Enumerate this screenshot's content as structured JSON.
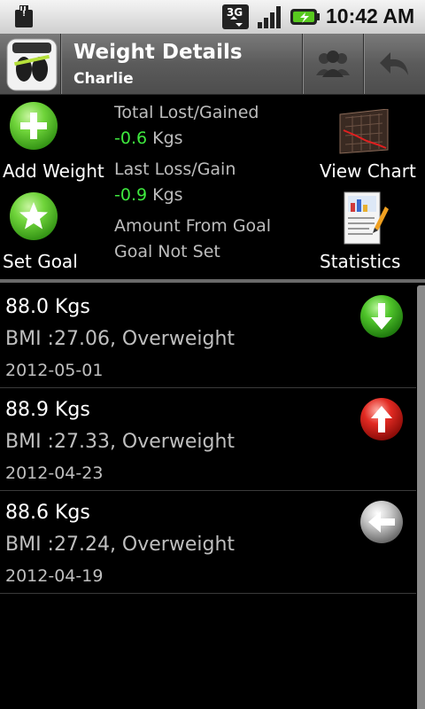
{
  "status": {
    "clock": "10:42 AM",
    "network": "3G"
  },
  "header": {
    "title": "Weight Details",
    "subtitle": "Charlie"
  },
  "actions": {
    "add_weight": "Add Weight",
    "set_goal": "Set Goal",
    "view_chart": "View Chart",
    "statistics": "Statistics"
  },
  "summary": {
    "total_label": "Total Lost/Gained",
    "total_value": "-0.6",
    "total_unit": "Kgs",
    "last_label": "Last Loss/Gain",
    "last_value": "-0.9",
    "last_unit": "Kgs",
    "goal_label": "Amount From Goal",
    "goal_value": "Goal Not Set"
  },
  "entries": [
    {
      "weight": "88.0 Kgs",
      "bmi": "BMI :27.06, Overweight",
      "date": "2012-05-01",
      "trend": "down",
      "color": "#3cbf2a"
    },
    {
      "weight": "88.9 Kgs",
      "bmi": "BMI :27.33, Overweight",
      "date": "2012-04-23",
      "trend": "up",
      "color": "#e02a2a"
    },
    {
      "weight": "88.6 Kgs",
      "bmi": "BMI :27.24, Overweight",
      "date": "2012-04-19",
      "trend": "same",
      "color": "#cfcfcf"
    }
  ]
}
